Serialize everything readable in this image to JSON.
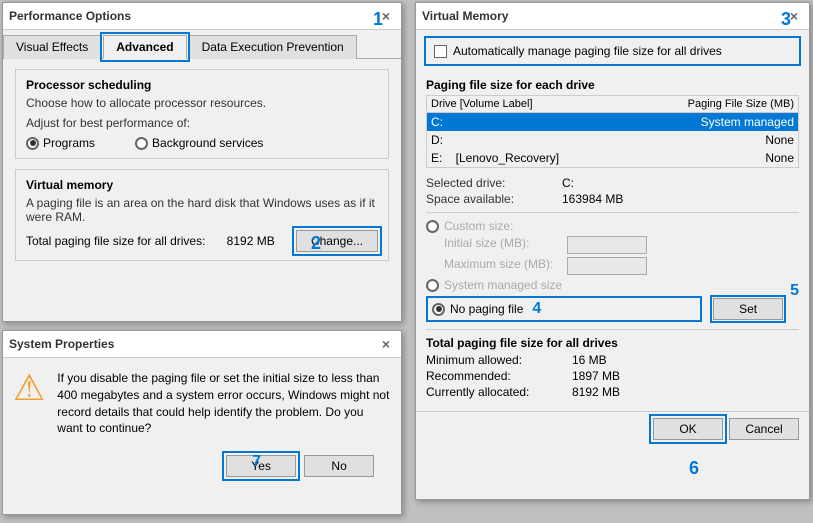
{
  "perf_options": {
    "title": "Performance Options",
    "close": "×",
    "tabs": [
      {
        "label": "Visual Effects",
        "active": false
      },
      {
        "label": "Advanced",
        "active": true
      },
      {
        "label": "Data Execution Prevention",
        "active": false
      }
    ],
    "processor_section": "Processor scheduling",
    "processor_desc": "Choose how to allocate processor resources.",
    "adjust_label": "Adjust for best performance of:",
    "radio_programs": "Programs",
    "radio_background": "Background services",
    "vm_section": "Virtual memory",
    "vm_desc1": "A paging file is an area on the hard disk that Windows uses as if it were RAM.",
    "vm_total_label": "Total paging file size for all drives:",
    "vm_total_value": "8192 MB",
    "change_btn": "Change...",
    "badge1": "1",
    "badge2": "2"
  },
  "virtual_memory": {
    "title": "Virtual Memory",
    "close": "×",
    "auto_manage_label": "Automatically manage paging file size for all drives",
    "paging_section": "Paging file size for each drive",
    "drive_col1": "Drive  [Volume Label]",
    "drive_col2": "Paging File Size (MB)",
    "drives": [
      {
        "letter": "C:",
        "label": "",
        "size": "System managed",
        "selected": true
      },
      {
        "letter": "D:",
        "label": "",
        "size": "None",
        "selected": false
      },
      {
        "letter": "E:",
        "label": "[Lenovo_Recovery]",
        "size": "None",
        "selected": false
      }
    ],
    "selected_drive_label": "Selected drive:",
    "selected_drive_value": "C:",
    "space_available_label": "Space available:",
    "space_available_value": "163984 MB",
    "custom_size_label": "Custom size:",
    "initial_size_label": "Initial size (MB):",
    "max_size_label": "Maximum size (MB):",
    "sys_managed_label": "System managed size",
    "no_paging_label": "No paging file",
    "set_btn": "Set",
    "total_section": "Total paging file size for all drives",
    "min_allowed_label": "Minimum allowed:",
    "min_allowed_value": "16 MB",
    "recommended_label": "Recommended:",
    "recommended_value": "1897 MB",
    "currently_label": "Currently allocated:",
    "currently_value": "8192 MB",
    "ok_btn": "OK",
    "cancel_btn": "Cancel",
    "badge3": "3",
    "badge4": "4",
    "badge5": "5",
    "badge6": "6"
  },
  "sys_props": {
    "title": "System Properties",
    "close": "×",
    "warning_text": "If you disable the paging file or set the initial size to less than 400 megabytes and a system error occurs, Windows might not record details that could help identify the problem. Do you want to continue?",
    "yes_btn": "Yes",
    "no_btn": "No",
    "badge7": "7"
  }
}
